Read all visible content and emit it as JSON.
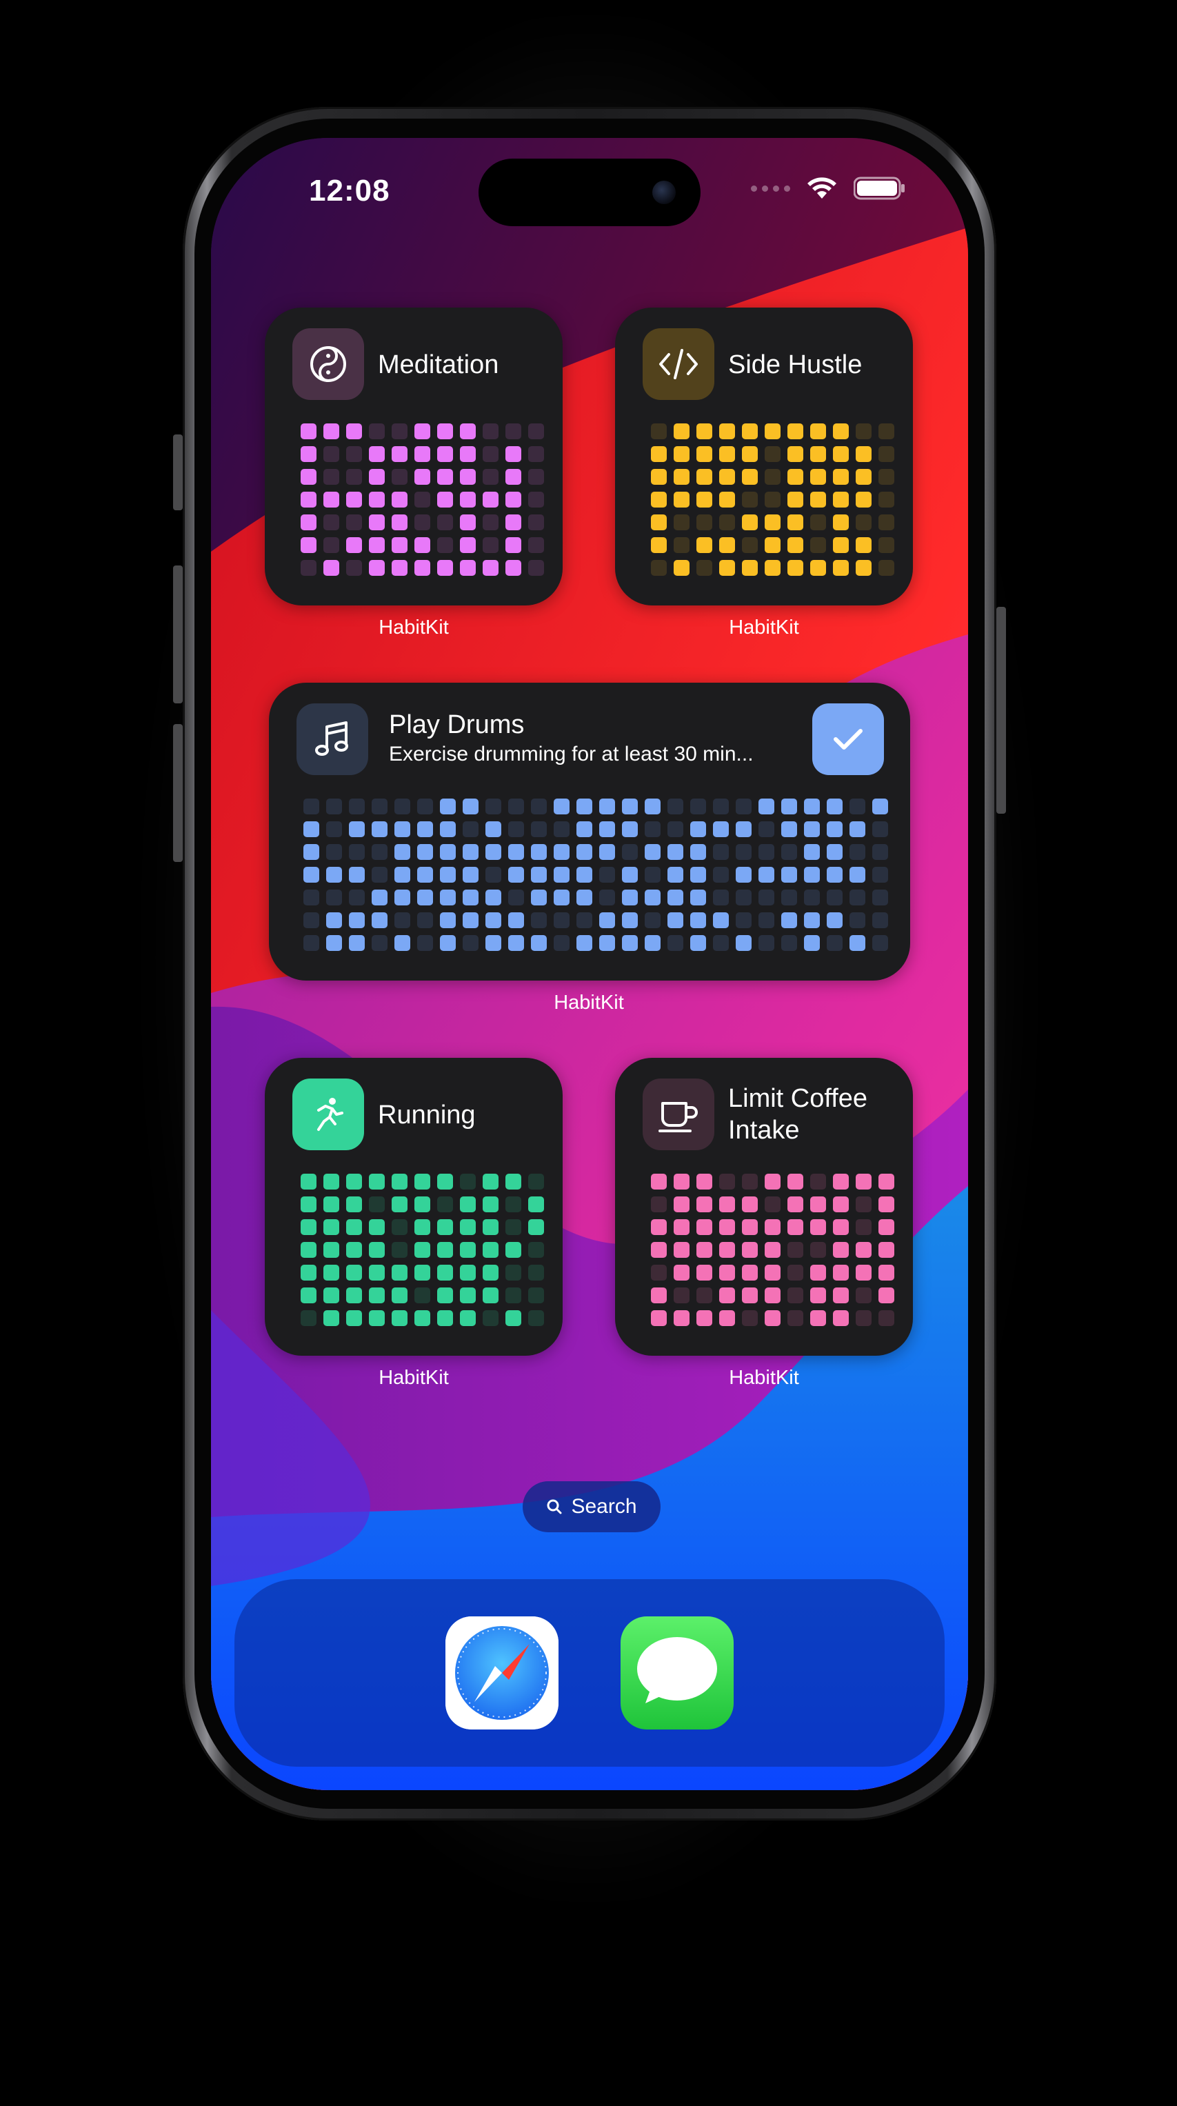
{
  "status_bar": {
    "time": "12:08"
  },
  "widgets": [
    {
      "id": "meditation",
      "title": "Meditation",
      "app_label": "HabitKit",
      "color": "#e879f9",
      "dim": "#3b2a3e",
      "icon": "yin-yang-icon",
      "icon_bg": "#4a3146",
      "cols": 11,
      "rows": 7,
      "pattern": [
        "11100111000",
        "10011111010",
        "10010111010",
        "11111011110",
        "10011001010",
        "10111101010",
        "01011111110"
      ]
    },
    {
      "id": "side-hustle",
      "title": "Side Hustle",
      "app_label": "HabitKit",
      "color": "#fbbf24",
      "dim": "#3d3420",
      "icon": "code-icon",
      "icon_bg": "#52421c",
      "cols": 11,
      "rows": 7,
      "pattern": [
        "01111111100",
        "11111011110",
        "11111011110",
        "11110011110",
        "10001110100",
        "10110110110",
        "01011111110"
      ]
    },
    {
      "id": "play-drums",
      "title": "Play Drums",
      "subtitle": "Exercise drumming for at least 30 min...",
      "app_label": "HabitKit",
      "color": "#7ba8f5",
      "dim": "#29303f",
      "icon": "music-note-icon",
      "icon_bg": "#2d3648",
      "check_color": "#7ba8f5",
      "cols": 26,
      "rows": 7,
      "pattern": [
        "00000011000111110000111101",
        "10111110100011100111011110",
        "10001111111111011100001100",
        "11101111011110101101111110",
        "00011111101110111100000000",
        "01110011110001101110011100",
        "01101010111011110101001010"
      ]
    },
    {
      "id": "running",
      "title": "Running",
      "app_label": "HabitKit",
      "color": "#34d399",
      "dim": "#1f3a32",
      "icon": "running-icon",
      "icon_bg": "#34d399",
      "cols": 11,
      "rows": 7,
      "pattern": [
        "11111110110",
        "11101101101",
        "11110111101",
        "11110111110",
        "11111111100",
        "11111011100",
        "01111111010"
      ]
    },
    {
      "id": "limit-coffee",
      "title": "Limit Coffee Intake",
      "app_label": "HabitKit",
      "color": "#f472b6",
      "dim": "#3e2a36",
      "icon": "coffee-cup-icon",
      "icon_bg": "#3e2a36",
      "cols": 11,
      "rows": 7,
      "pattern": [
        "11100110111",
        "01111011101",
        "11111111101",
        "11111100111",
        "01111101111",
        "10011101101",
        "11110101100"
      ]
    }
  ],
  "search": {
    "label": "Search"
  },
  "dock": {
    "apps": [
      {
        "name": "Safari"
      },
      {
        "name": "Messages"
      }
    ]
  }
}
